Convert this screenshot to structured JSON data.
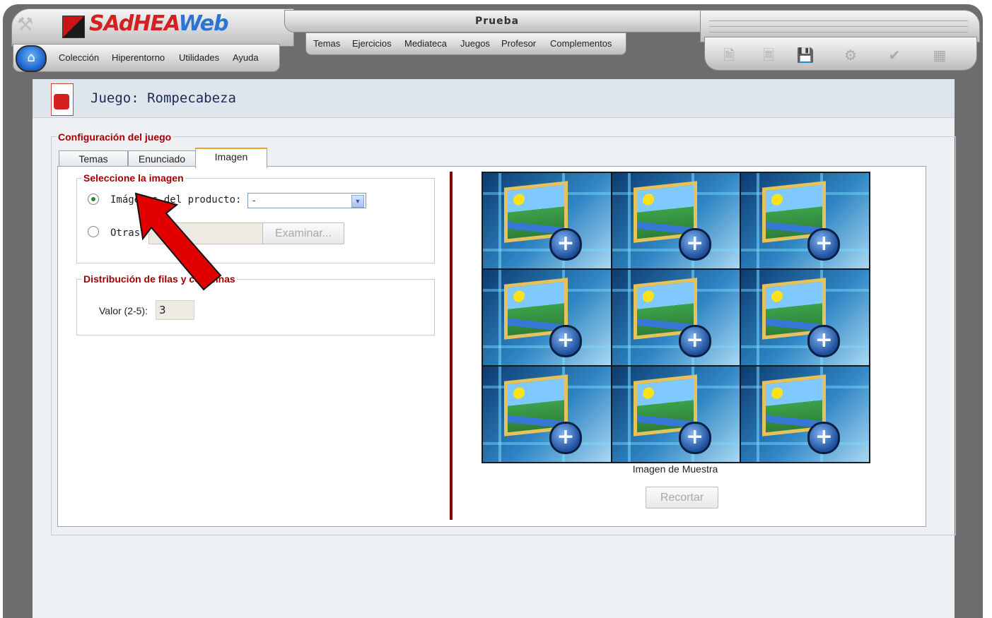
{
  "app": {
    "logo_text_a": "SAdHEA",
    "logo_text_b": "Web",
    "window_title": "Prueba"
  },
  "menu_left": [
    "Colección",
    "Hiperentorno",
    "Utilidades",
    "Ayuda"
  ],
  "menu_center": [
    "Temas",
    "Ejercicios",
    "Mediateca",
    "Juegos",
    "Profesor",
    "Complementos"
  ],
  "page": {
    "title": "Juego: Rompecabeza"
  },
  "config": {
    "legend": "Configuración del juego",
    "tabs": [
      {
        "label": "Temas",
        "active": false
      },
      {
        "label": "Enunciado",
        "active": false
      },
      {
        "label": "Imagen",
        "active": true
      }
    ]
  },
  "image_select": {
    "legend": "Seleccione la imagen",
    "option_product_label": "Imágenes del producto:",
    "option_product_selected": true,
    "product_select_value": "-",
    "option_other_label": "Otras:",
    "browse_label": "Examinar..."
  },
  "distribution": {
    "legend": "Distribución de filas y columnas",
    "value_label": "Valor (2-5):",
    "value": "3"
  },
  "preview": {
    "caption": "Imagen de Muestra",
    "crop_label": "Recortar",
    "grid": 3
  },
  "colors": {
    "accent_red": "#a00000",
    "divider": "#8b0000",
    "arrow": "#e00000"
  }
}
